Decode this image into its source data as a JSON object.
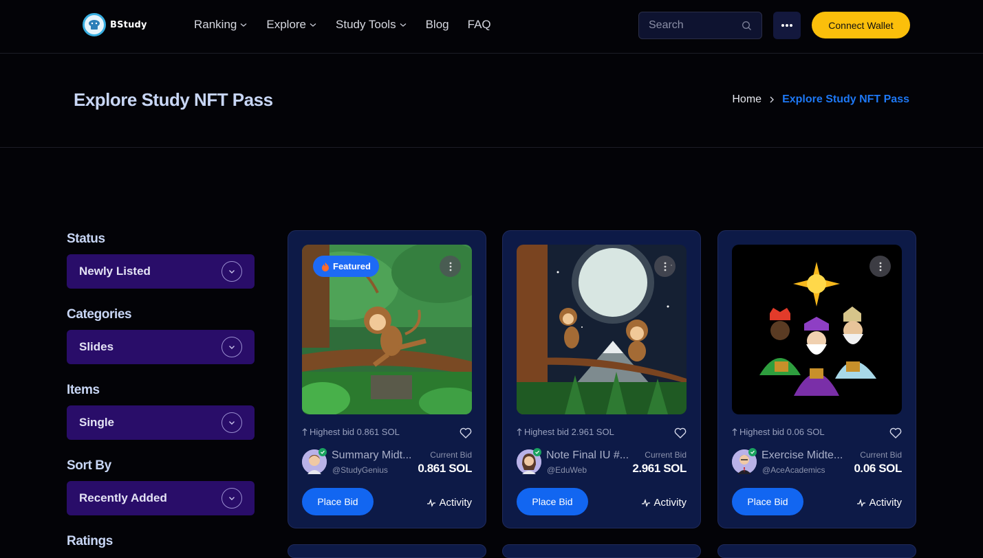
{
  "header": {
    "logo_text": "BStudy",
    "nav": [
      {
        "label": "Ranking",
        "has_dropdown": true
      },
      {
        "label": "Explore",
        "has_dropdown": true
      },
      {
        "label": "Study Tools",
        "has_dropdown": true
      },
      {
        "label": "Blog",
        "has_dropdown": false
      },
      {
        "label": "FAQ",
        "has_dropdown": false
      }
    ],
    "search_placeholder": "Search",
    "more_icon": "ellipsis-icon",
    "wallet_label": "Connect Wallet"
  },
  "banner": {
    "title": "Explore Study NFT Pass",
    "breadcrumb": {
      "home": "Home",
      "current": "Explore Study NFT Pass"
    }
  },
  "sidebar": {
    "filters": [
      {
        "label": "Status",
        "value": "Newly Listed"
      },
      {
        "label": "Categories",
        "value": "Slides"
      },
      {
        "label": "Items",
        "value": "Single"
      },
      {
        "label": "Sort By",
        "value": "Recently Added"
      },
      {
        "label": "Ratings",
        "value": ""
      }
    ]
  },
  "cards": [
    {
      "featured": "Featured",
      "highest_bid": "Highest bid 0.861 SOL",
      "title": "Summary Midt...",
      "owner": "@StudyGenius",
      "current_bid_label": "Current Bid",
      "current_bid": "0.861 SOL",
      "place_bid": "Place Bid",
      "activity": "Activity"
    },
    {
      "featured": "",
      "highest_bid": "Highest bid 2.961 SOL",
      "title": "Note Final IU #...",
      "owner": "@EduWeb",
      "current_bid_label": "Current Bid",
      "current_bid": "2.961 SOL",
      "place_bid": "Place Bid",
      "activity": "Activity"
    },
    {
      "featured": "",
      "highest_bid": "Highest bid 0.06 SOL",
      "title": "Exercise Midte...",
      "owner": "@AceAcademics",
      "current_bid_label": "Current Bid",
      "current_bid": "0.06 SOL",
      "place_bid": "Place Bid",
      "activity": "Activity"
    }
  ],
  "colors": {
    "accent_blue": "#1e78f5",
    "wallet_yellow": "#fbbf0b",
    "filter_purple": "#290d69",
    "card_bg": "#0d1a47"
  }
}
